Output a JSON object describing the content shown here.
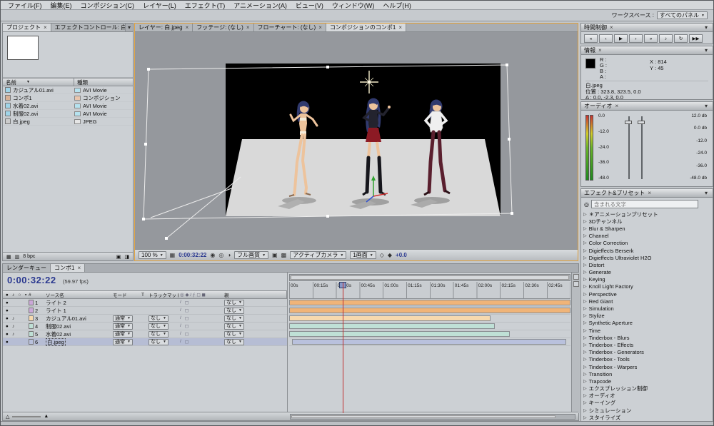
{
  "colors": {
    "accent_orange": "#e0a03c",
    "timecode_blue": "#2b3990",
    "cti_red": "#c03030"
  },
  "icons": {
    "close": "×",
    "panel_menu": "▾",
    "expander": "▷",
    "eye": "●",
    "speaker": "♪",
    "solo": "○",
    "lock": "▪",
    "pencil_hash": "#",
    "safe_areas": "▦",
    "snapshot": "◉",
    "show_snapshot": "◎",
    "channels": "◑",
    "roi": "▣",
    "grid": "▩",
    "pixel_aspect": "◇",
    "fast_preview": "◆",
    "sw_header": "◎ ◆ / ƒ ◻ ◼",
    "quality": "/",
    "cube": "◻",
    "zoom_out": "△",
    "zoom_in": "▲",
    "comp_tab": "▣"
  },
  "menu": {
    "items": [
      "ファイル(F)",
      "編集(E)",
      "コンポジション(C)",
      "レイヤー(L)",
      "エフェクト(T)",
      "アニメーション(A)",
      "ビュー(V)",
      "ウィンドウ(W)",
      "ヘルプ(H)"
    ]
  },
  "workspace": {
    "label": "ワークスペース :",
    "value": "すべてのパネル"
  },
  "project": {
    "tab": "プロジェクト",
    "tab2": "エフェクトコントロール: 白.jpeg",
    "name_col": "名前",
    "type_col": "種類",
    "footer_bpc": "8 bpc",
    "items": [
      {
        "name": "カジュアル01.avi",
        "type": "AVI Movie",
        "chip": "#b5e2ef",
        "icon": "#9fd4e8"
      },
      {
        "name": "コンポ1",
        "type": "コンポジション",
        "chip": "#e9c5ad",
        "icon": "#d8b095"
      },
      {
        "name": "水着02.avi",
        "type": "AVI Movie",
        "chip": "#b5e2ef",
        "icon": "#9fd4e8"
      },
      {
        "name": "制服02.avi",
        "type": "AVI Movie",
        "chip": "#b5e2ef",
        "icon": "#9fd4e8"
      },
      {
        "name": "白.jpeg",
        "type": "JPEG",
        "chip": "#e6e6e6",
        "icon": "#cccccc"
      }
    ]
  },
  "viewer": {
    "tabs": [
      {
        "label": "レイヤー: 白.jpeg",
        "active": false
      },
      {
        "label": "フッテージ: (なし)",
        "active": false
      },
      {
        "label": "フローチャート: (なし)",
        "active": false
      },
      {
        "label": "コンポジションのコンポ1",
        "active": true
      }
    ],
    "zoom": "100 %",
    "timecode": "0:00:32:22",
    "quality": "フル画質",
    "camera": "アクティブカメラ",
    "layout": "1画面",
    "exposure": "+0.0"
  },
  "time_controls": {
    "title": "時間制御",
    "buttons": [
      {
        "name": "first-frame-button",
        "glyph": "«"
      },
      {
        "name": "prev-frame-button",
        "glyph": "‹"
      },
      {
        "name": "play-button",
        "glyph": "▶"
      },
      {
        "name": "next-frame-button",
        "glyph": "›"
      },
      {
        "name": "last-frame-button",
        "glyph": "»"
      },
      {
        "name": "audio-toggle-button",
        "glyph": "♪"
      },
      {
        "name": "loop-button",
        "glyph": "↻"
      },
      {
        "name": "ram-preview-button",
        "glyph": "▶▶"
      }
    ]
  },
  "info": {
    "title": "情報",
    "r": "R :",
    "g": "G :",
    "b": "B :",
    "a": "A :",
    "x": "X : 814",
    "y": "Y : 45",
    "source": "白.jpeg",
    "position": "位置 : 323.8, 323.5, 0.0",
    "delta": "Δ : 0.0, -2.3, 0.0"
  },
  "audio": {
    "title": "オーディオ",
    "meter_scale": [
      "0.0",
      "-12.0",
      "-24.0",
      "-36.0",
      "-48.0"
    ],
    "slider_scale": [
      "12.0 db",
      "0.0 db",
      "-12.0",
      "-24.0",
      "-36.0",
      "-48.0 db"
    ]
  },
  "effects": {
    "title": "エフェクト&プリセット",
    "search_placeholder": "含まれる文字",
    "items": [
      "＊アニメーションプリセット",
      "3Dチャンネル",
      "Blur & Sharpen",
      "Channel",
      "Color Correction",
      "Digieffects Berserk",
      "Digieffects Ultraviolet H2O",
      "Distort",
      "Generate",
      "Keying",
      "Knoll Light Factory",
      "Perspective",
      "Red Giant",
      "Simulation",
      "Stylize",
      "Synthetic Aperture",
      "Time",
      "Tinderbox - Blurs",
      "Tinderbox - Effects",
      "Tinderbox - Generators",
      "Tinderbox - Tools",
      "Tinderbox - Warpers",
      "Transition",
      "Trapcode",
      "エクスプレッション制御",
      "オーディオ",
      "キーイング",
      "シミュレーション",
      "スタイライズ"
    ]
  },
  "timeline": {
    "tab_render_queue": "レンダーキュー",
    "tab_comp": "コンポ1",
    "timecode": "0:00:32:22",
    "fps": "(59.97 fps)",
    "col_source": "ソース名",
    "col_mode": "モード",
    "col_t": "T",
    "col_trkmat": "トラックマット",
    "col_parent": "親",
    "ruler": [
      "00s",
      "00:15s",
      "00:30s",
      "00:45s",
      "01:00s",
      "01:15s",
      "01:30s",
      "01:45s",
      "02:00s",
      "02:15s",
      "02:30s",
      "02:45s"
    ],
    "layers": [
      {
        "num": "1",
        "name": "ライト 2",
        "mode": "",
        "trkmat": "",
        "parent": "なし",
        "chip": "#cba8d8",
        "bar": "#f0b478",
        "bar_l": "0%",
        "bar_w": "100%",
        "audio": false,
        "selected": false
      },
      {
        "num": "2",
        "name": "ライト 1",
        "mode": "",
        "trkmat": "",
        "parent": "なし",
        "chip": "#cba8d8",
        "bar": "#f0b478",
        "bar_l": "0%",
        "bar_w": "100%",
        "audio": false,
        "selected": false
      },
      {
        "num": "3",
        "name": "カジュアル01.avi",
        "mode": "通常",
        "trkmat": "なし",
        "parent": "なし",
        "chip": "#f6d9ae",
        "bar": "#f6d9ae",
        "bar_l": "0%",
        "bar_w": "71.5%",
        "audio": true,
        "selected": false
      },
      {
        "num": "4",
        "name": "制服02.avi",
        "mode": "通常",
        "trkmat": "なし",
        "parent": "なし",
        "chip": "#bfe0d6",
        "bar": "#bfe0d6",
        "bar_l": "0%",
        "bar_w": "73%",
        "audio": true,
        "selected": false
      },
      {
        "num": "5",
        "name": "水着02.avi",
        "mode": "通常",
        "trkmat": "なし",
        "parent": "なし",
        "chip": "#bfe0d6",
        "bar": "#bfe0d6",
        "bar_l": "0%",
        "bar_w": "78.5%",
        "audio": true,
        "selected": false
      },
      {
        "num": "6",
        "name": "白.jpeg",
        "mode": "通常",
        "trkmat": "なし",
        "parent": "なし",
        "chip": "#b9c1dd",
        "bar": "#b9c1dd",
        "bar_l": "1%",
        "bar_w": "97.5%",
        "audio": false,
        "selected": true
      }
    ]
  }
}
